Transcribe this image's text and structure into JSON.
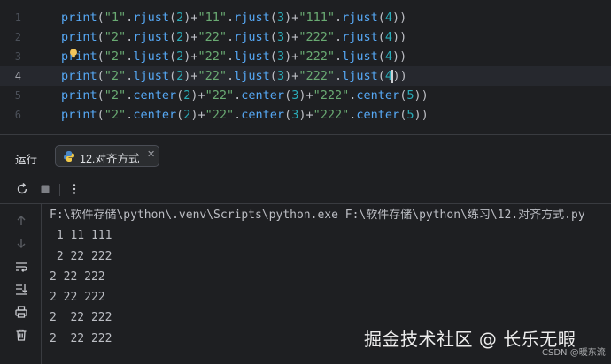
{
  "editor": {
    "line_numbers": [
      "1",
      "2",
      "3",
      "4",
      "5",
      "6"
    ],
    "lines": [
      [
        [
          "kw",
          "print"
        ],
        [
          "dot",
          "("
        ],
        [
          "str",
          "\"1\""
        ],
        [
          "dot",
          "."
        ],
        [
          "kw",
          "rjust"
        ],
        [
          "dot",
          "("
        ],
        [
          "num",
          "2"
        ],
        [
          "dot",
          ")+"
        ],
        [
          "str",
          "\"11\""
        ],
        [
          "dot",
          "."
        ],
        [
          "kw",
          "rjust"
        ],
        [
          "dot",
          "("
        ],
        [
          "num",
          "3"
        ],
        [
          "dot",
          ")+"
        ],
        [
          "str",
          "\"111\""
        ],
        [
          "dot",
          "."
        ],
        [
          "kw",
          "rjust"
        ],
        [
          "dot",
          "("
        ],
        [
          "num",
          "4"
        ],
        [
          "dot",
          "))"
        ]
      ],
      [
        [
          "kw",
          "print"
        ],
        [
          "dot",
          "("
        ],
        [
          "str",
          "\"2\""
        ],
        [
          "dot",
          "."
        ],
        [
          "kw",
          "rjust"
        ],
        [
          "dot",
          "("
        ],
        [
          "num",
          "2"
        ],
        [
          "dot",
          ")+"
        ],
        [
          "str",
          "\"22\""
        ],
        [
          "dot",
          "."
        ],
        [
          "kw",
          "rjust"
        ],
        [
          "dot",
          "("
        ],
        [
          "num",
          "3"
        ],
        [
          "dot",
          ")+"
        ],
        [
          "str",
          "\"222\""
        ],
        [
          "dot",
          "."
        ],
        [
          "kw",
          "rjust"
        ],
        [
          "dot",
          "("
        ],
        [
          "num",
          "4"
        ],
        [
          "dot",
          "))"
        ]
      ],
      [
        [
          "kw",
          "print"
        ],
        [
          "dot",
          "("
        ],
        [
          "str",
          "\"2\""
        ],
        [
          "dot",
          "."
        ],
        [
          "kw",
          "ljust"
        ],
        [
          "dot",
          "("
        ],
        [
          "num",
          "2"
        ],
        [
          "dot",
          ")+"
        ],
        [
          "str",
          "\"22\""
        ],
        [
          "dot",
          "."
        ],
        [
          "kw",
          "ljust"
        ],
        [
          "dot",
          "("
        ],
        [
          "num",
          "3"
        ],
        [
          "dot",
          ")+"
        ],
        [
          "str",
          "\"222\""
        ],
        [
          "dot",
          "."
        ],
        [
          "kw",
          "ljust"
        ],
        [
          "dot",
          "("
        ],
        [
          "num",
          "4"
        ],
        [
          "dot",
          "))"
        ]
      ],
      [
        [
          "kw",
          "print"
        ],
        [
          "dot",
          "("
        ],
        [
          "str",
          "\"2\""
        ],
        [
          "dot",
          "."
        ],
        [
          "kw",
          "ljust"
        ],
        [
          "dot",
          "("
        ],
        [
          "num",
          "2"
        ],
        [
          "dot",
          ")+"
        ],
        [
          "str",
          "\"22\""
        ],
        [
          "dot",
          "."
        ],
        [
          "kw",
          "ljust"
        ],
        [
          "dot",
          "("
        ],
        [
          "num",
          "3"
        ],
        [
          "dot",
          ")+"
        ],
        [
          "str",
          "\"222\""
        ],
        [
          "dot",
          "."
        ],
        [
          "kw",
          "ljust"
        ],
        [
          "dot",
          "("
        ],
        [
          "num",
          "4"
        ],
        [
          "caret",
          ""
        ],
        [
          "dot",
          "))"
        ]
      ],
      [
        [
          "kw",
          "print"
        ],
        [
          "dot",
          "("
        ],
        [
          "str",
          "\"2\""
        ],
        [
          "dot",
          "."
        ],
        [
          "kw",
          "center"
        ],
        [
          "dot",
          "("
        ],
        [
          "num",
          "2"
        ],
        [
          "dot",
          ")+"
        ],
        [
          "str",
          "\"22\""
        ],
        [
          "dot",
          "."
        ],
        [
          "kw",
          "center"
        ],
        [
          "dot",
          "("
        ],
        [
          "num",
          "3"
        ],
        [
          "dot",
          ")+"
        ],
        [
          "str",
          "\"222\""
        ],
        [
          "dot",
          "."
        ],
        [
          "kw",
          "center"
        ],
        [
          "dot",
          "("
        ],
        [
          "num",
          "5"
        ],
        [
          "dot",
          "))"
        ]
      ],
      [
        [
          "kw",
          "print"
        ],
        [
          "dot",
          "("
        ],
        [
          "str",
          "\"2\""
        ],
        [
          "dot",
          "."
        ],
        [
          "kw",
          "center"
        ],
        [
          "dot",
          "("
        ],
        [
          "num",
          "2"
        ],
        [
          "dot",
          ")+"
        ],
        [
          "str",
          "\"22\""
        ],
        [
          "dot",
          "."
        ],
        [
          "kw",
          "center"
        ],
        [
          "dot",
          "("
        ],
        [
          "num",
          "3"
        ],
        [
          "dot",
          ")+"
        ],
        [
          "str",
          "\"222\""
        ],
        [
          "dot",
          "."
        ],
        [
          "kw",
          "center"
        ],
        [
          "dot",
          "("
        ],
        [
          "num",
          "5"
        ],
        [
          "dot",
          "))"
        ]
      ]
    ]
  },
  "run_panel": {
    "label": "运行",
    "tab_label": "12.对齐方式",
    "tab_close": "✕"
  },
  "console": {
    "lines": [
      "F:\\软件存储\\python\\.venv\\Scripts\\python.exe F:\\软件存储\\python\\练习\\12.对齐方式.py",
      " 1 11 111",
      " 2 22 222",
      "2 22 222",
      "2 22 222",
      "2  22 222",
      "2  22 222"
    ]
  },
  "watermark": {
    "main": "掘金技术社区 @ 长乐无暇",
    "sub": "CSDN @暖东流"
  },
  "icons": {
    "bulb": "lightbulb-icon",
    "python": "python-icon",
    "rerun": "rerun-icon",
    "stop": "stop-icon",
    "more": "more-vertical-icon",
    "up": "arrow-up-icon",
    "down": "arrow-down-icon",
    "wrap": "soft-wrap-icon",
    "scroll_end": "scroll-to-end-icon",
    "print": "print-icon",
    "trash": "trash-icon"
  }
}
